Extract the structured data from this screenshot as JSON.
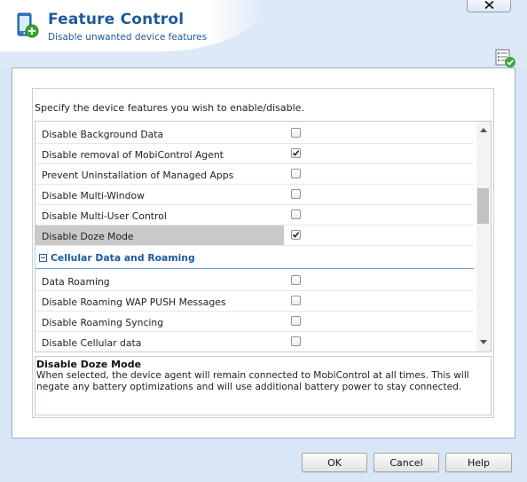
{
  "dialog": {
    "title": "Feature Control",
    "subtitle": "Disable unwanted device features"
  },
  "instruction": "Specify the device features you wish to enable/disable.",
  "features": [
    {
      "label": "Disable Background Data",
      "checked": false,
      "selected": false
    },
    {
      "label": "Disable removal of MobiControl Agent",
      "checked": true,
      "selected": false
    },
    {
      "label": "Prevent Uninstallation of Managed Apps",
      "checked": false,
      "selected": false
    },
    {
      "label": "Disable Multi-Window",
      "checked": false,
      "selected": false
    },
    {
      "label": "Disable Multi-User Control",
      "checked": false,
      "selected": false
    },
    {
      "label": "Disable Doze Mode",
      "checked": true,
      "selected": true
    }
  ],
  "section": {
    "label": "Cellular Data and Roaming",
    "expanded": true
  },
  "section_features": [
    {
      "label": "Data Roaming",
      "checked": false
    },
    {
      "label": "Disable Roaming WAP PUSH Messages",
      "checked": false
    },
    {
      "label": "Disable Roaming Syncing",
      "checked": false
    },
    {
      "label": "Disable Cellular data",
      "checked": false
    }
  ],
  "description": {
    "title": "Disable Doze Mode",
    "text": "When selected, the device agent will remain connected to MobiControl at all times. This will negate any battery optimizations and will use additional battery power to stay connected."
  },
  "buttons": {
    "ok": "OK",
    "cancel": "Cancel",
    "help": "Help"
  },
  "icons": {
    "app": "device-settings-icon",
    "close": "close-icon",
    "checklist": "checklist-check-icon"
  },
  "colors": {
    "accent": "#1f5a99",
    "section": "#1e5aa0",
    "selected_row": "#c9c9c9",
    "check_green": "#3aa935"
  }
}
